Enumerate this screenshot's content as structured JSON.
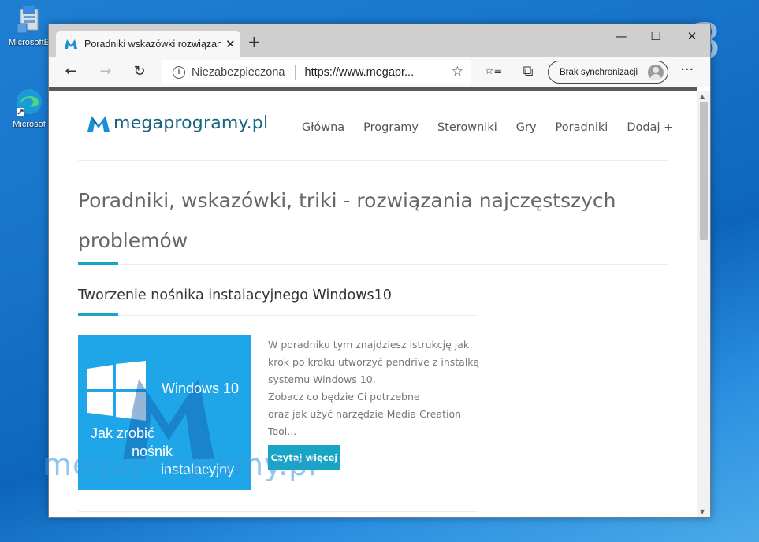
{
  "desktop": {
    "icons": [
      {
        "label": "MicrosoftE",
        "icon": "installer-icon"
      },
      {
        "label": "Microsof",
        "icon": "edge-icon"
      }
    ],
    "corner_number": "3"
  },
  "browser": {
    "tab": {
      "title": "Poradniki wskazówki rozwiązania",
      "close": "✕"
    },
    "new_tab": "+",
    "window_controls": {
      "minimize": "—",
      "maximize": "☐",
      "close": "✕"
    },
    "toolbar": {
      "back": "←",
      "forward": "→",
      "refresh": "↻",
      "security_label": "Niezabezpieczona",
      "url": "https://www.megapr...",
      "favorite": "☆",
      "favorites_bar": "☆≡",
      "collections": "⧉",
      "sync_label": "Brak synchronizacji",
      "menu": "···"
    }
  },
  "site": {
    "logo_text": "megaprogramy.pl",
    "nav": [
      "Główna",
      "Programy",
      "Sterowniki",
      "Gry",
      "Poradniki",
      "Dodaj +"
    ],
    "page_title": "Poradniki, wskazówki, triki - rozwiązania najczęstszych problemów",
    "article": {
      "title": "Tworzenie nośnika instalacyjnego Windows10",
      "image": {
        "windows_label": "Windows 10",
        "caption_lines": [
          "Jak zrobić",
          "nośnik",
          "instalacyjny"
        ]
      },
      "excerpt_lines": [
        "W poradniku tym znajdziesz istrukcję jak",
        "krok po kroku utworzyć pendrive z instalką",
        "systemu Windows 10.",
        "Zobacz co będzie Ci potrzebne",
        "oraz jak użyć narzędzie Media Creation",
        "Tool..."
      ],
      "read_more": "Czytaj więcej"
    },
    "watermark": "megaprogramy.pl"
  },
  "colors": {
    "accent": "#18a4c5",
    "logo": "#17657f",
    "desktop": "#1673c9"
  }
}
